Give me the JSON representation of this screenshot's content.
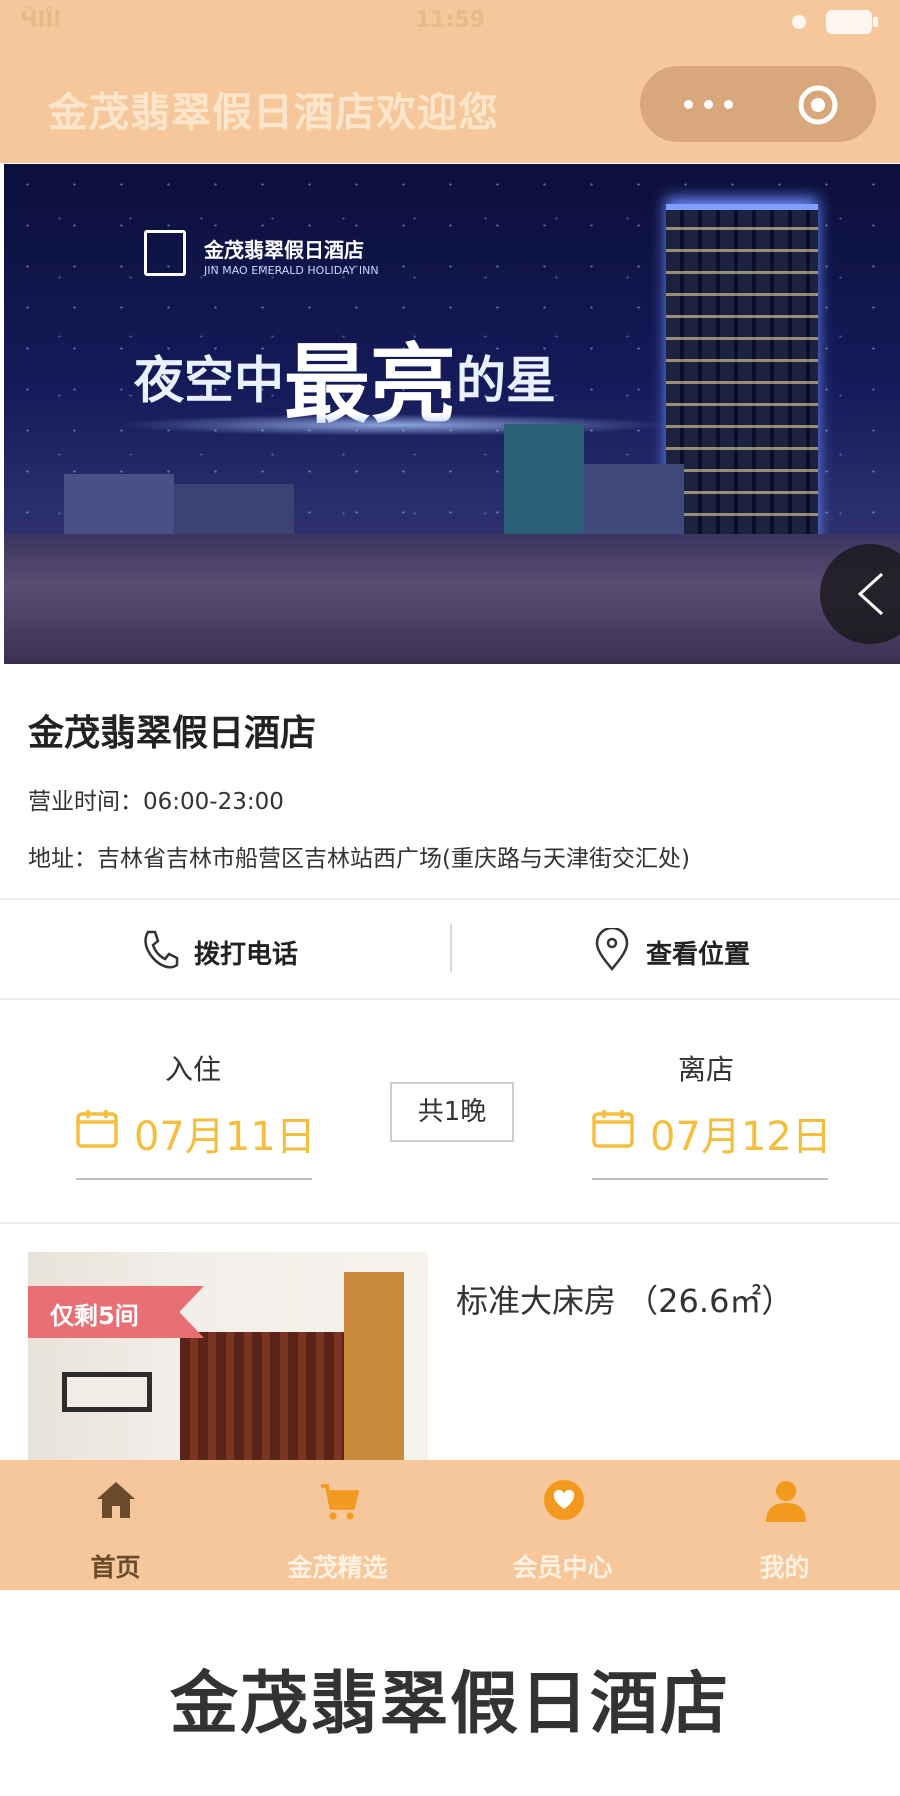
{
  "status_bar": {
    "signal": "ӴlI̊l",
    "time": "11:59"
  },
  "header": {
    "title": "金茂翡翠假日酒店欢迎您"
  },
  "banner": {
    "logo_text": "金茂翡翠假日酒店",
    "logo_sub": "JIN MAO EMERALD HOLIDAY INN",
    "slogan": {
      "part1": "夜空中",
      "big1": "最",
      "big2": "亮",
      "part2": "的星"
    }
  },
  "hotel": {
    "name": "金茂翡翠假日酒店",
    "hours": "营业时间：06:00-23:00",
    "address": "地址：吉林省吉林市船营区吉林站西广场(重庆路与天津街交汇处)"
  },
  "actions": {
    "call_label": "拨打电话",
    "location_label": "查看位置"
  },
  "booking": {
    "checkin_label": "入住",
    "checkin_date": "07月11日",
    "nights": "共1晚",
    "checkout_label": "离店",
    "checkout_date": "07月12日"
  },
  "room": {
    "badge": "仅剩5间",
    "title": "标准大床房 （26.6㎡）"
  },
  "tabbar": {
    "tabs": [
      {
        "label": "首页",
        "icon": "home-icon"
      },
      {
        "label": "金茂精选",
        "icon": "cart-icon"
      },
      {
        "label": "会员中心",
        "icon": "heart-badge-icon"
      },
      {
        "label": "我的",
        "icon": "user-icon"
      }
    ]
  },
  "footer": {
    "title": "金茂翡翠假日酒店"
  },
  "colors": {
    "header_bg": "#f5c79a",
    "accent": "#f4bf3e",
    "badge": "#ea6f74",
    "tab_active": "#6b4a2e"
  }
}
